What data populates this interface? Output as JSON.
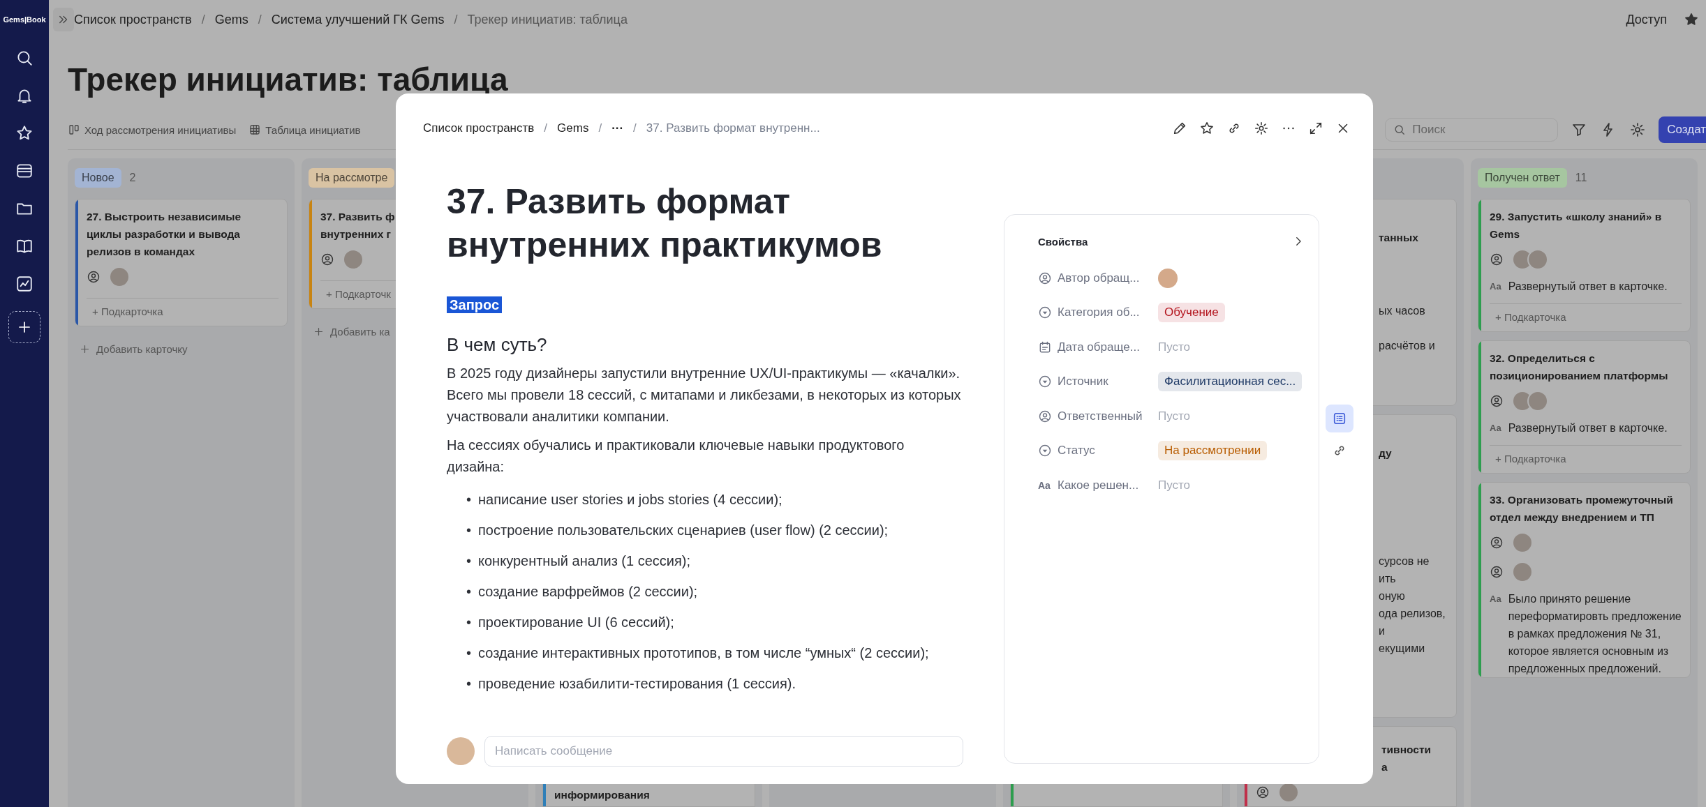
{
  "sidebar": {
    "logo": "Gems|Book"
  },
  "separator": "/",
  "breadcrumbs": [
    "Список пространств",
    "Gems",
    "Система улучшений ГК Gems",
    "Трекер инициатив: таблица"
  ],
  "access": "Доступ",
  "page_title": "Трекер инициатив: таблица",
  "views": [
    {
      "label": "Ход рассмотрения инициативы",
      "kind": "board"
    },
    {
      "label": "Таблица инициатив",
      "kind": "table"
    }
  ],
  "search": {
    "placeholder": "Поиск"
  },
  "create_button": "Создат",
  "columns": [
    {
      "kind": "full",
      "header": {
        "label": "Новое",
        "count": "2",
        "color": "#a3b4d3"
      },
      "cards": [
        {
          "title": "27. Выстроить независимые циклы разработки и вывода релизов в командах",
          "color": "#2a57a8",
          "avatar_rows": [
            {
              "avatars": [
                {
                  "kind": "photo"
                }
              ]
            }
          ],
          "subcard": "+ Подкарточка"
        }
      ],
      "add": "Добавить карточку"
    },
    {
      "kind": "clipped",
      "header": {
        "label": "На рассмотре",
        "color": "#d9c3a3"
      },
      "cards": [
        {
          "title": "37. Развить ф\nвнутренних г",
          "color": "#c88412",
          "avatar_rows": [
            {
              "avatars": [
                {
                  "kind": "photo"
                }
              ]
            }
          ],
          "subcard": "+ Подкарточк"
        }
      ],
      "add": "Добавить ка"
    },
    {
      "kind": "bottom",
      "cards": [
        {
          "title": "информирования",
          "color": "#2f7fb8"
        }
      ]
    },
    {
      "kind": "bottom"
    },
    {
      "kind": "bottom",
      "cards": [
        {
          "kind": "blank",
          "color": "#2d9d4e"
        }
      ]
    },
    {
      "kind": "right_edge",
      "cards": [
        {
          "title": "танных",
          "body": "ых часов\n\nрасчётов и"
        },
        {
          "title": "ду",
          "body": "сурсов не\nить\nоную\nода релизов,\nи\nекущими"
        },
        {
          "title": "тивности\nа",
          "color": "#c0304b",
          "avatar_rows": [
            {
              "avatars": [
                {
                  "kind": "photo"
                }
              ]
            }
          ]
        }
      ]
    },
    {
      "kind": "full",
      "header": {
        "label": "Получен ответ",
        "count": "11",
        "color": "#a6c6a0"
      },
      "cards": [
        {
          "title": "29. Запустить «школу знаний» в Gems",
          "color": "#2d9d4e",
          "avatar_rows": [
            {
              "avatars": [
                {
                  "kind": "photo"
                },
                {
                  "kind": "photo"
                }
              ]
            }
          ],
          "answer": {
            "icon": "Aa",
            "text": "Развернутый ответ в карточке."
          },
          "subcard": "+ Подкарточка"
        },
        {
          "title": "32. Определиться с позиционированием платформы",
          "color": "#2d9d4e",
          "avatar_rows": [
            {
              "avatars": [
                {
                  "kind": "photo"
                },
                {
                  "kind": "photo"
                }
              ]
            }
          ],
          "answer": {
            "icon": "Aa",
            "text": "Развернутый ответ в карточке."
          },
          "subcard": "+ Подкарточка"
        },
        {
          "title": "33. Организовать промежуточный отдел между внедрением и ТП",
          "color": "#2d9d4e",
          "avatar_rows": [
            {
              "avatars": [
                {
                  "kind": "photo"
                }
              ]
            },
            {
              "avatars": [
                {
                  "kind": "photo"
                }
              ]
            }
          ],
          "answer": {
            "icon": "Aa",
            "text": "Было принято решение переформатировть предложение в рамках предложения № 31, которое является основным из предложенных предложений."
          }
        }
      ]
    }
  ],
  "modal": {
    "separator": "/",
    "breadcrumbs": [
      {
        "text": "Список пространств",
        "kind": "link"
      },
      {
        "text": "Gems",
        "kind": "link"
      },
      {
        "text": "···",
        "kind": "more"
      },
      {
        "text": "37. Развить формат внутренн...",
        "kind": "current"
      }
    ],
    "title": "37. Развить формат внутренних практикумов",
    "tag": "Запрос",
    "heading": "В чем суть?",
    "paragraphs": [
      "В 2025 году дизайнеры запустили внутренние UX/UI-практикумы — «качалки». Всего мы провели 18 сессий, с митапами и ликбезами, в некоторых из которых участвовали аналитики компании.",
      "На сессиях обучались и практиковали ключевые навыки продуктового дизайна:"
    ],
    "bullet": "•",
    "bullets": [
      "написание user stories и jobs stories (4 сессии);",
      "построение пользовательских сценариев (user flow) (2 сессии);",
      "конкурентный анализ (1 сессия);",
      "создание варфреймов (2 сессии);",
      "проектирование UI (6 сессий);",
      "создание интерактивных прототипов, в том числе “умных“ (2 сессии);",
      "проведение юзабилити-тестирования (1 сессия)."
    ],
    "comment": {
      "placeholder": "Написать сообщение"
    },
    "properties": {
      "title": "Свойства",
      "rows": [
        {
          "label": "Автор обращ...",
          "kind": "person",
          "avatar": true
        },
        {
          "label": "Категория об...",
          "kind": "select",
          "value": "Обучение",
          "color": "#b3141d"
        },
        {
          "label": "Дата обраще...",
          "kind": "date",
          "empty": "Пусто"
        },
        {
          "label": "Источник",
          "kind": "select",
          "value": "Фасилитационная сес...",
          "color": "#1f3a66"
        },
        {
          "label": "Ответственный",
          "kind": "person",
          "empty": "Пусто"
        },
        {
          "label": "Статус",
          "kind": "select",
          "value": "На рассмотрении",
          "color": "#b85c00"
        },
        {
          "label": "Какое решен...",
          "kind": "text",
          "icon": "Aa",
          "empty": "Пусто"
        }
      ]
    },
    "rail": [
      {
        "kind": "properties",
        "selected": true
      },
      {
        "kind": "links",
        "selected": false
      }
    ]
  }
}
